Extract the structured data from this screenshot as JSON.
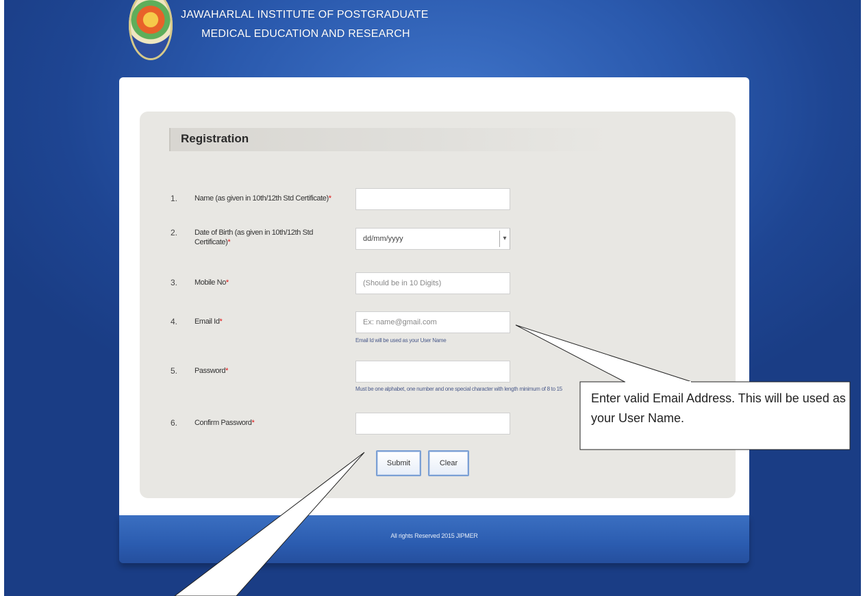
{
  "header": {
    "institute_line1": "JAWAHARLAL INSTITUTE OF POSTGRADUATE",
    "institute_line2": "MEDICAL EDUCATION AND RESEARCH",
    "logo_icon": "institute-emblem"
  },
  "registration": {
    "title": "Registration",
    "fields": [
      {
        "num": "1.",
        "label": "Name (as given in 10th/12th Std Certificate)",
        "value": "",
        "placeholder": ""
      },
      {
        "num": "2.",
        "label": "Date of Birth (as given in 10th/12th Std Certificate)",
        "value": "dd/mm/yyyy",
        "placeholder": ""
      },
      {
        "num": "3.",
        "label": "Mobile No",
        "value": "",
        "placeholder": "(Should be in 10 Digits)"
      },
      {
        "num": "4.",
        "label": "Email Id",
        "value": "",
        "placeholder": "Ex: name@gmail.com"
      },
      {
        "num": "5.",
        "label": "Password",
        "value": "",
        "placeholder": ""
      },
      {
        "num": "6.",
        "label": "Confirm Password",
        "value": "",
        "placeholder": ""
      }
    ],
    "required_mark": "*",
    "email_hint": "Email Id will be used as your User Name",
    "password_hint": "Must be one alphabet, one number and one special character with length minimum of 8 to 15",
    "submit_label": "Submit",
    "clear_label": "Clear"
  },
  "footer": {
    "text": "All rights Reserved 2015 JIPMER"
  },
  "callout": {
    "text": "Enter valid Email Address. This will be used as your User Name."
  }
}
